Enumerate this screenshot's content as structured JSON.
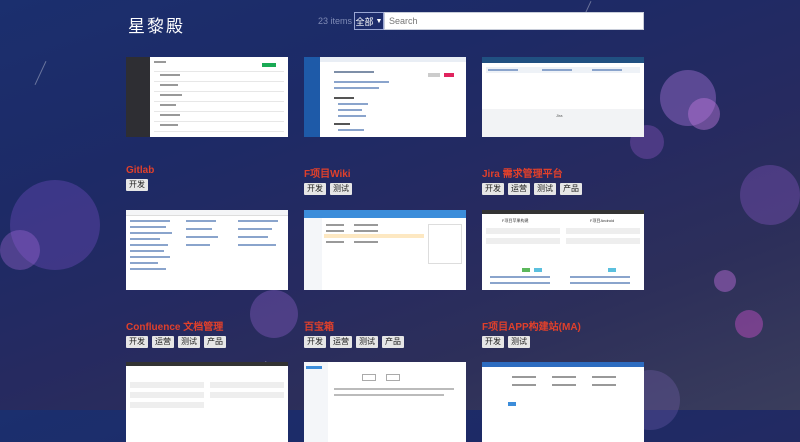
{
  "app": {
    "title": "星黎殿"
  },
  "toolbar": {
    "item_count": "23 items",
    "category": "全部",
    "search_placeholder": "Search"
  },
  "colors": {
    "accent": "#e0402b",
    "tag_bg": "#e6e6e6"
  },
  "sites": [
    {
      "name": "Gitlab",
      "tags": [
        "开发"
      ]
    },
    {
      "name": "F项目Wiki",
      "tags": [
        "开发",
        "测试"
      ]
    },
    {
      "name": "Jira 需求管理平台",
      "tags": [
        "开发",
        "运营",
        "测试",
        "产品"
      ]
    },
    {
      "name": "Confluence 文档管理",
      "tags": [
        "开发",
        "运营",
        "测试",
        "产品"
      ]
    },
    {
      "name": "百宝箱",
      "tags": [
        "开发",
        "运营",
        "测试",
        "产品"
      ]
    },
    {
      "name": "F项目APP构建站(MA)",
      "tags": [
        "开发",
        "测试"
      ]
    }
  ],
  "thumb_texts": {
    "jira_footer": "Jira",
    "app_title_left": "F项目苹果构建",
    "app_title_right": "F项目Android"
  }
}
